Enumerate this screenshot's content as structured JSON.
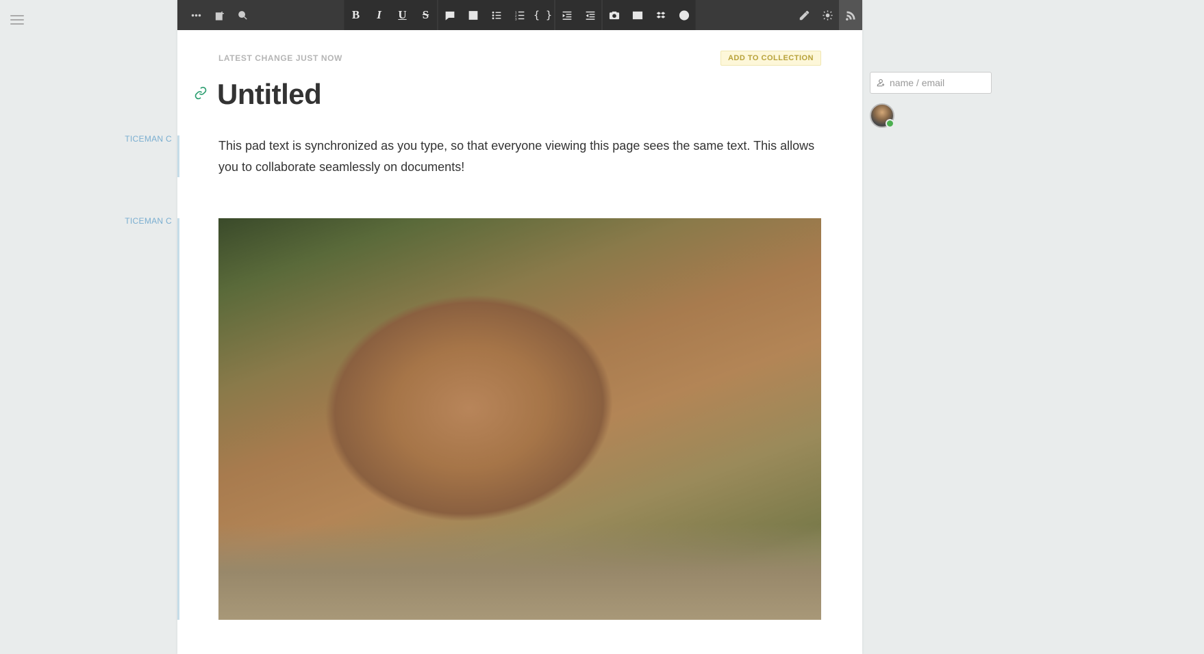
{
  "toolbar": {
    "bold": "B",
    "italic": "I",
    "underline": "U",
    "strike": "S"
  },
  "meta": {
    "last_change": "LATEST CHANGE JUST NOW",
    "add_collection": "ADD TO COLLECTION"
  },
  "document": {
    "title": "Untitled",
    "body": "This pad text is synchronized as you type, so that everyone viewing this page sees the same text.  This allows you to collaborate seamlessly on documents!"
  },
  "authors": {
    "tag1": "TICEMAN C",
    "tag2": "TICEMAN C"
  },
  "invite": {
    "placeholder": "name / email"
  }
}
